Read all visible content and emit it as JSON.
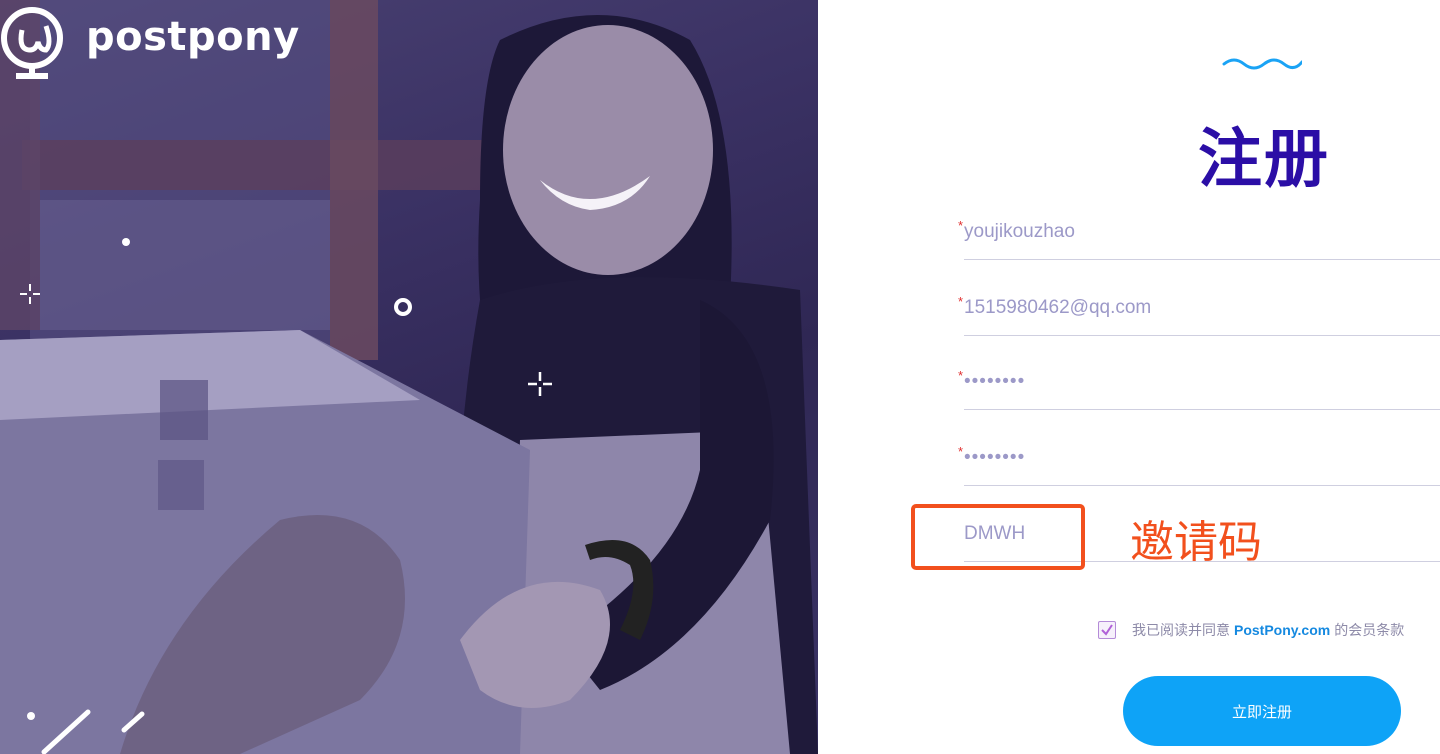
{
  "brand": {
    "name": "postpony"
  },
  "form": {
    "title": "注册",
    "required_mark": "*",
    "username_value": "youjikouzhao",
    "email_value": "1515980462@qq.com",
    "password_value": "••••••••",
    "confirm_password_value": "••••••••",
    "invite_code_value": "DMWH",
    "invite_annotation": "邀请码",
    "agree_prefix": "我已阅读并同意",
    "agree_brand": "PostPony.com",
    "agree_suffix": "的会员条款",
    "agree_checked": true,
    "submit_label": "立即注册"
  },
  "colors": {
    "accent": "#0ea3f7",
    "title": "#2b0ea6",
    "annotation": "#f2501d"
  }
}
